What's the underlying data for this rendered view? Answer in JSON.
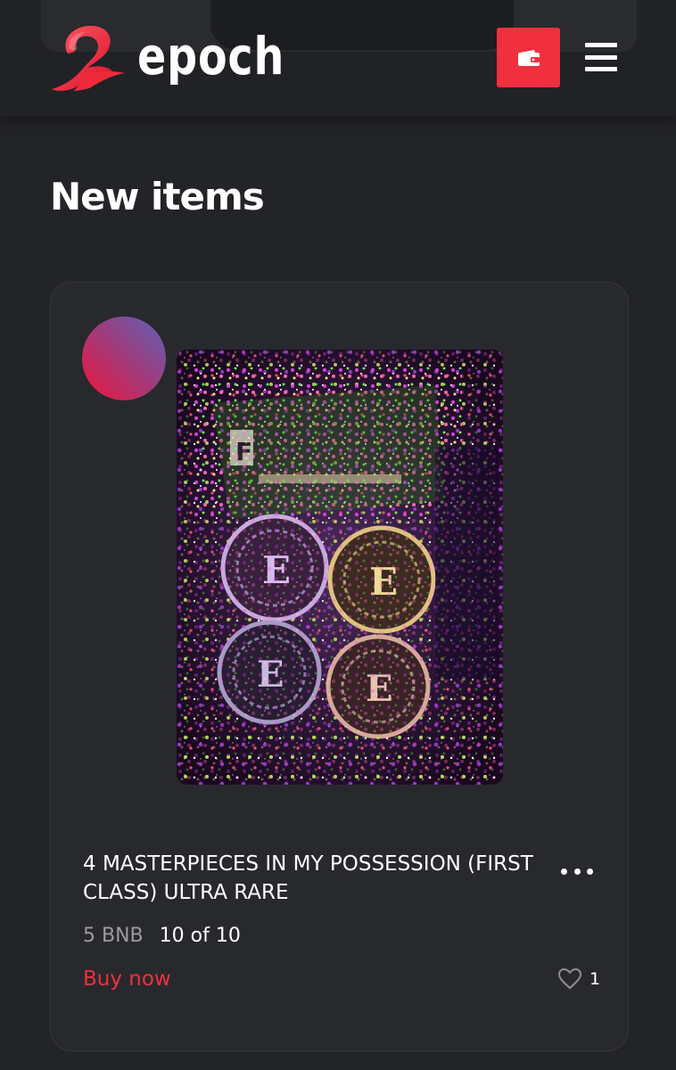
{
  "brand": {
    "name": "epoch",
    "accent": "#f0303f"
  },
  "header": {
    "wallet_icon": "wallet-icon",
    "menu_icon": "hamburger-menu-icon"
  },
  "section": {
    "title": "New items"
  },
  "item": {
    "creator_avatar": "gradient-avatar",
    "title": "4 MASTERPIECES IN MY POSSESSION (FIRST CLASS) ULTRA RARE",
    "price": "5 BNB",
    "stock": "10 of 10",
    "buy_label": "Buy now",
    "likes": "1",
    "more_icon": "more-dots-icon",
    "like_icon": "heart-outline-icon"
  }
}
